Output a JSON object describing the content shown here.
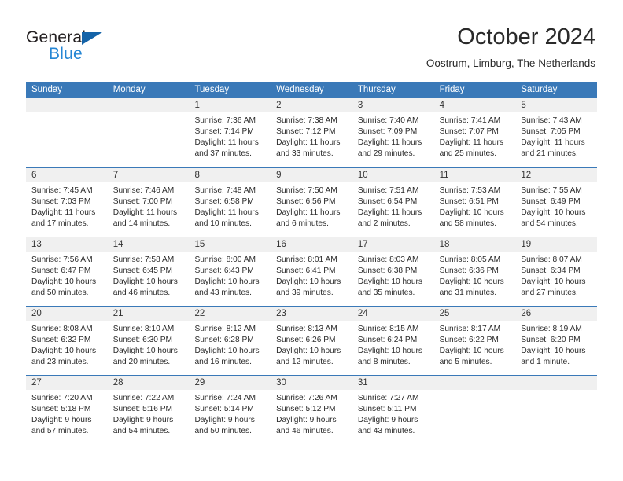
{
  "brand": {
    "name_part1": "General",
    "name_part2": "Blue",
    "triangle_color": "#1463a8",
    "blue_text_color": "#2586d4"
  },
  "header": {
    "title": "October 2024",
    "subtitle": "Oostrum, Limburg, The Netherlands"
  },
  "theme": {
    "header_band_color": "#3a79b8",
    "row_divider_color": "#3a79b8",
    "day_band_color": "#f0f0f0"
  },
  "weekdays": [
    "Sunday",
    "Monday",
    "Tuesday",
    "Wednesday",
    "Thursday",
    "Friday",
    "Saturday"
  ],
  "weeks": [
    [
      {
        "day": "",
        "empty": true
      },
      {
        "day": "",
        "empty": true
      },
      {
        "day": "1",
        "sunrise": "Sunrise: 7:36 AM",
        "sunset": "Sunset: 7:14 PM",
        "daylight_line1": "Daylight: 11 hours",
        "daylight_line2": "and 37 minutes."
      },
      {
        "day": "2",
        "sunrise": "Sunrise: 7:38 AM",
        "sunset": "Sunset: 7:12 PM",
        "daylight_line1": "Daylight: 11 hours",
        "daylight_line2": "and 33 minutes."
      },
      {
        "day": "3",
        "sunrise": "Sunrise: 7:40 AM",
        "sunset": "Sunset: 7:09 PM",
        "daylight_line1": "Daylight: 11 hours",
        "daylight_line2": "and 29 minutes."
      },
      {
        "day": "4",
        "sunrise": "Sunrise: 7:41 AM",
        "sunset": "Sunset: 7:07 PM",
        "daylight_line1": "Daylight: 11 hours",
        "daylight_line2": "and 25 minutes."
      },
      {
        "day": "5",
        "sunrise": "Sunrise: 7:43 AM",
        "sunset": "Sunset: 7:05 PM",
        "daylight_line1": "Daylight: 11 hours",
        "daylight_line2": "and 21 minutes."
      }
    ],
    [
      {
        "day": "6",
        "sunrise": "Sunrise: 7:45 AM",
        "sunset": "Sunset: 7:03 PM",
        "daylight_line1": "Daylight: 11 hours",
        "daylight_line2": "and 17 minutes."
      },
      {
        "day": "7",
        "sunrise": "Sunrise: 7:46 AM",
        "sunset": "Sunset: 7:00 PM",
        "daylight_line1": "Daylight: 11 hours",
        "daylight_line2": "and 14 minutes."
      },
      {
        "day": "8",
        "sunrise": "Sunrise: 7:48 AM",
        "sunset": "Sunset: 6:58 PM",
        "daylight_line1": "Daylight: 11 hours",
        "daylight_line2": "and 10 minutes."
      },
      {
        "day": "9",
        "sunrise": "Sunrise: 7:50 AM",
        "sunset": "Sunset: 6:56 PM",
        "daylight_line1": "Daylight: 11 hours",
        "daylight_line2": "and 6 minutes."
      },
      {
        "day": "10",
        "sunrise": "Sunrise: 7:51 AM",
        "sunset": "Sunset: 6:54 PM",
        "daylight_line1": "Daylight: 11 hours",
        "daylight_line2": "and 2 minutes."
      },
      {
        "day": "11",
        "sunrise": "Sunrise: 7:53 AM",
        "sunset": "Sunset: 6:51 PM",
        "daylight_line1": "Daylight: 10 hours",
        "daylight_line2": "and 58 minutes."
      },
      {
        "day": "12",
        "sunrise": "Sunrise: 7:55 AM",
        "sunset": "Sunset: 6:49 PM",
        "daylight_line1": "Daylight: 10 hours",
        "daylight_line2": "and 54 minutes."
      }
    ],
    [
      {
        "day": "13",
        "sunrise": "Sunrise: 7:56 AM",
        "sunset": "Sunset: 6:47 PM",
        "daylight_line1": "Daylight: 10 hours",
        "daylight_line2": "and 50 minutes."
      },
      {
        "day": "14",
        "sunrise": "Sunrise: 7:58 AM",
        "sunset": "Sunset: 6:45 PM",
        "daylight_line1": "Daylight: 10 hours",
        "daylight_line2": "and 46 minutes."
      },
      {
        "day": "15",
        "sunrise": "Sunrise: 8:00 AM",
        "sunset": "Sunset: 6:43 PM",
        "daylight_line1": "Daylight: 10 hours",
        "daylight_line2": "and 43 minutes."
      },
      {
        "day": "16",
        "sunrise": "Sunrise: 8:01 AM",
        "sunset": "Sunset: 6:41 PM",
        "daylight_line1": "Daylight: 10 hours",
        "daylight_line2": "and 39 minutes."
      },
      {
        "day": "17",
        "sunrise": "Sunrise: 8:03 AM",
        "sunset": "Sunset: 6:38 PM",
        "daylight_line1": "Daylight: 10 hours",
        "daylight_line2": "and 35 minutes."
      },
      {
        "day": "18",
        "sunrise": "Sunrise: 8:05 AM",
        "sunset": "Sunset: 6:36 PM",
        "daylight_line1": "Daylight: 10 hours",
        "daylight_line2": "and 31 minutes."
      },
      {
        "day": "19",
        "sunrise": "Sunrise: 8:07 AM",
        "sunset": "Sunset: 6:34 PM",
        "daylight_line1": "Daylight: 10 hours",
        "daylight_line2": "and 27 minutes."
      }
    ],
    [
      {
        "day": "20",
        "sunrise": "Sunrise: 8:08 AM",
        "sunset": "Sunset: 6:32 PM",
        "daylight_line1": "Daylight: 10 hours",
        "daylight_line2": "and 23 minutes."
      },
      {
        "day": "21",
        "sunrise": "Sunrise: 8:10 AM",
        "sunset": "Sunset: 6:30 PM",
        "daylight_line1": "Daylight: 10 hours",
        "daylight_line2": "and 20 minutes."
      },
      {
        "day": "22",
        "sunrise": "Sunrise: 8:12 AM",
        "sunset": "Sunset: 6:28 PM",
        "daylight_line1": "Daylight: 10 hours",
        "daylight_line2": "and 16 minutes."
      },
      {
        "day": "23",
        "sunrise": "Sunrise: 8:13 AM",
        "sunset": "Sunset: 6:26 PM",
        "daylight_line1": "Daylight: 10 hours",
        "daylight_line2": "and 12 minutes."
      },
      {
        "day": "24",
        "sunrise": "Sunrise: 8:15 AM",
        "sunset": "Sunset: 6:24 PM",
        "daylight_line1": "Daylight: 10 hours",
        "daylight_line2": "and 8 minutes."
      },
      {
        "day": "25",
        "sunrise": "Sunrise: 8:17 AM",
        "sunset": "Sunset: 6:22 PM",
        "daylight_line1": "Daylight: 10 hours",
        "daylight_line2": "and 5 minutes."
      },
      {
        "day": "26",
        "sunrise": "Sunrise: 8:19 AM",
        "sunset": "Sunset: 6:20 PM",
        "daylight_line1": "Daylight: 10 hours",
        "daylight_line2": "and 1 minute."
      }
    ],
    [
      {
        "day": "27",
        "sunrise": "Sunrise: 7:20 AM",
        "sunset": "Sunset: 5:18 PM",
        "daylight_line1": "Daylight: 9 hours",
        "daylight_line2": "and 57 minutes."
      },
      {
        "day": "28",
        "sunrise": "Sunrise: 7:22 AM",
        "sunset": "Sunset: 5:16 PM",
        "daylight_line1": "Daylight: 9 hours",
        "daylight_line2": "and 54 minutes."
      },
      {
        "day": "29",
        "sunrise": "Sunrise: 7:24 AM",
        "sunset": "Sunset: 5:14 PM",
        "daylight_line1": "Daylight: 9 hours",
        "daylight_line2": "and 50 minutes."
      },
      {
        "day": "30",
        "sunrise": "Sunrise: 7:26 AM",
        "sunset": "Sunset: 5:12 PM",
        "daylight_line1": "Daylight: 9 hours",
        "daylight_line2": "and 46 minutes."
      },
      {
        "day": "31",
        "sunrise": "Sunrise: 7:27 AM",
        "sunset": "Sunset: 5:11 PM",
        "daylight_line1": "Daylight: 9 hours",
        "daylight_line2": "and 43 minutes."
      },
      {
        "day": "",
        "empty": true
      },
      {
        "day": "",
        "empty": true
      }
    ]
  ]
}
